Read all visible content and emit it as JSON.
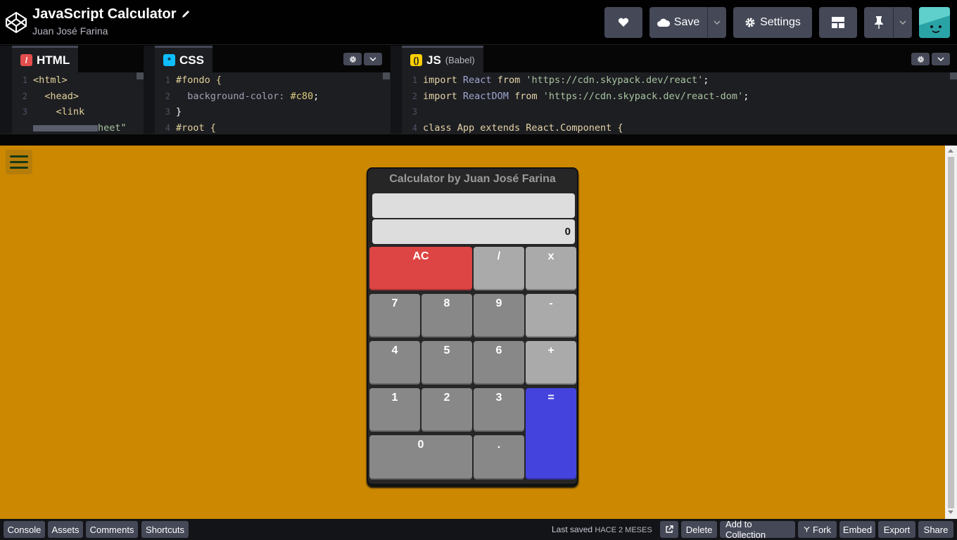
{
  "header": {
    "title": "JavaScript Calculator",
    "author": "Juan José Farina",
    "save_label": "Save",
    "settings_label": "Settings"
  },
  "editors": {
    "html": {
      "label": "HTML",
      "lines": [
        {
          "n": "1",
          "text": "<html>"
        },
        {
          "n": "2",
          "text": "  <head>"
        },
        {
          "n": "3",
          "text": "    <link"
        },
        {
          "n": "",
          "text": "heet\""
        }
      ]
    },
    "css": {
      "label": "CSS",
      "lines": [
        {
          "n": "1",
          "text": "#fondo {"
        },
        {
          "n": "2",
          "prop": "  background-color:",
          "val": " #c80",
          "end": ";"
        },
        {
          "n": "3",
          "text": "}"
        },
        {
          "n": "4",
          "text": "#root {"
        }
      ]
    },
    "js": {
      "label": "JS",
      "sublabel": "(Babel)",
      "lines": [
        {
          "n": "1",
          "kw1": "import",
          "id": " React",
          "kw2": " from",
          "str": " 'https://cdn.skypack.dev/react'",
          "end": ";"
        },
        {
          "n": "2",
          "kw1": "import",
          "id": " ReactDOM",
          "kw2": " from",
          "str": " 'https://cdn.skypack.dev/react-dom'",
          "end": ";"
        },
        {
          "n": "3",
          "text": ""
        },
        {
          "n": "4",
          "text": "class App extends React.Component {"
        }
      ]
    }
  },
  "calculator": {
    "title": "Calculator by Juan José Farina",
    "formula": "",
    "display": "0",
    "keys": {
      "ac": "AC",
      "divide": "/",
      "multiply": "x",
      "seven": "7",
      "eight": "8",
      "nine": "9",
      "subtract": "-",
      "four": "4",
      "five": "5",
      "six": "6",
      "add": "+",
      "one": "1",
      "two": "2",
      "three": "3",
      "equals": "=",
      "zero": "0",
      "decimal": "."
    }
  },
  "footer": {
    "console": "Console",
    "assets": "Assets",
    "comments": "Comments",
    "shortcuts": "Shortcuts",
    "last_saved_label": "Last saved",
    "last_saved_when": "HACE 2 MESES",
    "delete": "Delete",
    "add_to_collection": "Add to Collection",
    "fork": "Fork",
    "embed": "Embed",
    "export": "Export",
    "share": "Share"
  },
  "colors": {
    "preview_bg": "#cc8800",
    "ac": "#dd4444",
    "operator": "#aaaaaa",
    "number": "#888888",
    "equals": "#4443dd"
  },
  "icons": [
    "codepen-logo-icon",
    "pencil-icon",
    "heart-icon",
    "cloud-icon",
    "chevron-down-icon",
    "gear-icon",
    "layout-icon",
    "pin-icon",
    "avatar",
    "hamburger-menu-icon",
    "external-link-icon",
    "fork-icon"
  ]
}
